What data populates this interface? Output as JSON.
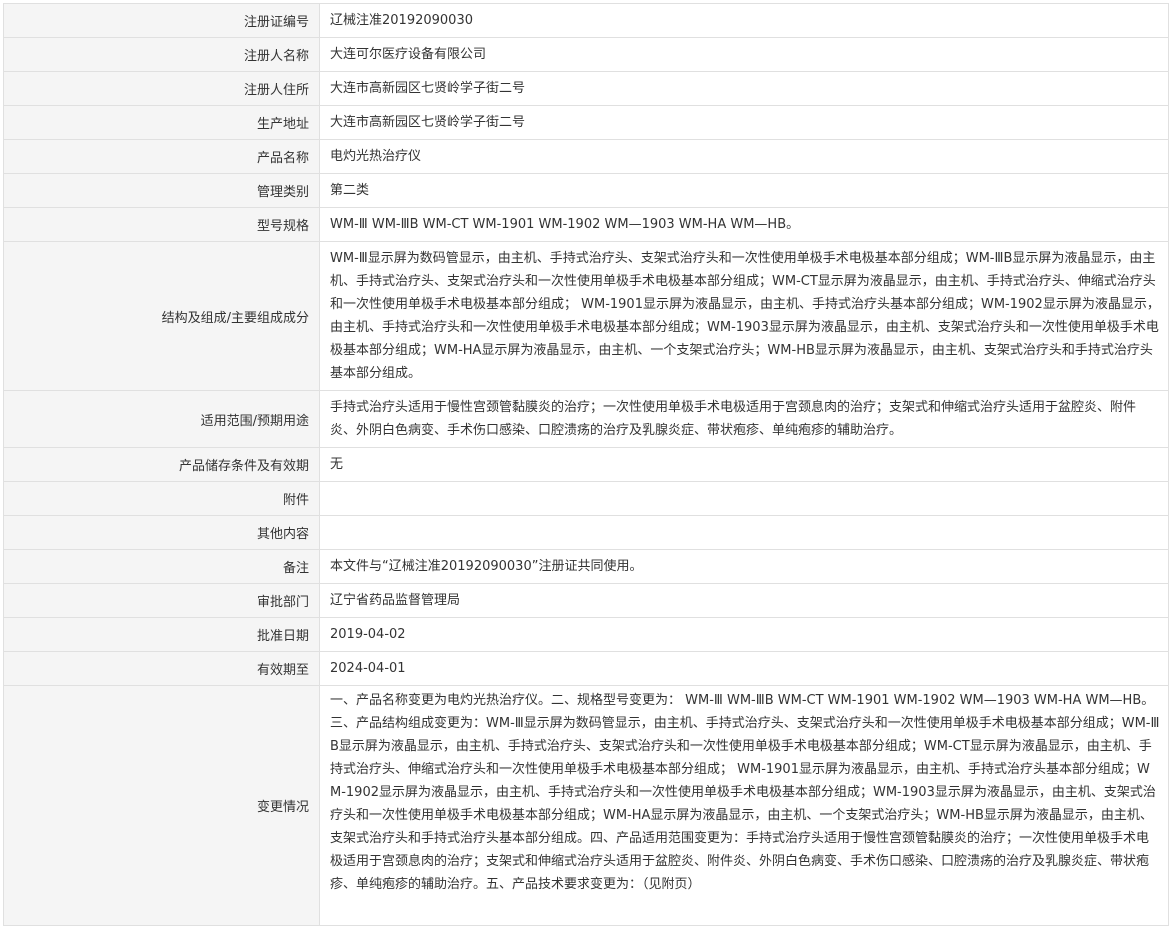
{
  "record": {
    "rows": [
      {
        "label": "注册证编号",
        "value": "辽械注准20192090030"
      },
      {
        "label": "注册人名称",
        "value": "大连可尔医疗设备有限公司"
      },
      {
        "label": "注册人住所",
        "value": "大连市高新园区七贤岭学子街二号"
      },
      {
        "label": "生产地址",
        "value": "大连市高新园区七贤岭学子街二号"
      },
      {
        "label": "产品名称",
        "value": "电灼光热治疗仪"
      },
      {
        "label": "管理类别",
        "value": "第二类"
      },
      {
        "label": "型号规格",
        "value": "WM-Ⅲ WM-ⅢB WM-CT WM-1901 WM-1902 WM—1903 WM-HA WM—HB。"
      },
      {
        "label": "结构及组成/主要组成成分",
        "value": "WM-Ⅲ显示屏为数码管显示，由主机、手持式治疗头、支架式治疗头和一次性使用单极手术电极基本部分组成；WM-ⅢB显示屏为液晶显示，由主机、手持式治疗头、支架式治疗头和一次性使用单极手术电极基本部分组成；WM-CT显示屏为液晶显示，由主机、手持式治疗头、伸缩式治疗头和一次性使用单极手术电极基本部分组成； WM-1901显示屏为液晶显示，由主机、手持式治疗头基本部分组成；WM-1902显示屏为液晶显示，由主机、手持式治疗头和一次性使用单极手术电极基本部分组成；WM-1903显示屏为液晶显示，由主机、支架式治疗头和一次性使用单极手术电极基本部分组成；WM-HA显示屏为液晶显示，由主机、一个支架式治疗头；WM-HB显示屏为液晶显示，由主机、支架式治疗头和手持式治疗头基本部分组成。"
      },
      {
        "label": "适用范围/预期用途",
        "value": "手持式治疗头适用于慢性宫颈管黏膜炎的治疗；一次性使用单极手术电极适用于宫颈息肉的治疗；支架式和伸缩式治疗头适用于盆腔炎、附件炎、外阴白色病变、手术伤口感染、口腔溃疡的治疗及乳腺炎症、带状疱疹、单纯疱疹的辅助治疗。"
      },
      {
        "label": "产品储存条件及有效期",
        "value": "无"
      },
      {
        "label": "附件",
        "value": ""
      },
      {
        "label": "其他内容",
        "value": ""
      },
      {
        "label": "备注",
        "value": "本文件与“辽械注准20192090030”注册证共同使用。"
      },
      {
        "label": "审批部门",
        "value": "辽宁省药品监督管理局"
      },
      {
        "label": "批准日期",
        "value": "2019-04-02"
      },
      {
        "label": "有效期至",
        "value": "2024-04-01"
      },
      {
        "label": "变更情况",
        "value": "一、产品名称变更为电灼光热治疗仪。二、规格型号变更为： WM-Ⅲ WM-ⅢB WM-CT WM-1901 WM-1902 WM—1903 WM-HA WM—HB。三、产品结构组成变更为：WM-Ⅲ显示屏为数码管显示，由主机、手持式治疗头、支架式治疗头和一次性使用单极手术电极基本部分组成；WM-ⅢB显示屏为液晶显示，由主机、手持式治疗头、支架式治疗头和一次性使用单极手术电极基本部分组成；WM-CT显示屏为液晶显示，由主机、手持式治疗头、伸缩式治疗头和一次性使用单极手术电极基本部分组成； WM-1901显示屏为液晶显示，由主机、手持式治疗头基本部分组成；WM-1902显示屏为液晶显示，由主机、手持式治疗头和一次性使用单极手术电极基本部分组成；WM-1903显示屏为液晶显示，由主机、支架式治疗头和一次性使用单极手术电极基本部分组成；WM-HA显示屏为液晶显示，由主机、一个支架式治疗头；WM-HB显示屏为液晶显示，由主机、支架式治疗头和手持式治疗头基本部分组成。四、产品适用范围变更为：手持式治疗头适用于慢性宫颈管黏膜炎的治疗；一次性使用单极手术电极适用于宫颈息肉的治疗；支架式和伸缩式治疗头适用于盆腔炎、附件炎、外阴白色病变、手术伤口感染、口腔溃疡的治疗及乳腺炎症、带状疱疹、单纯疱疹的辅助治疗。五、产品技术要求变更为：（见附页）"
      }
    ]
  }
}
